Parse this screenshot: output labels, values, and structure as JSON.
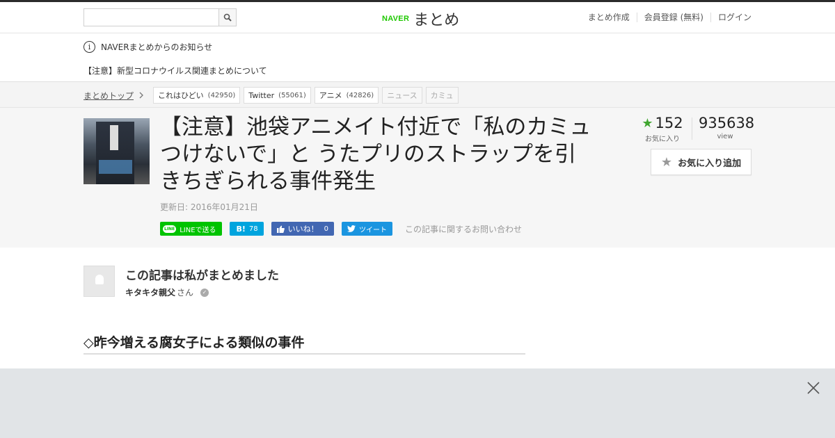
{
  "header": {
    "search_placeholder": "",
    "logo_brand": "NAVER",
    "logo_text": "まとめ",
    "nav": [
      "まとめ作成",
      "会員登録 (無料)",
      "ログイン"
    ]
  },
  "notice": {
    "heading": "NAVERまとめからのお知らせ",
    "link": "【注意】新型コロナウイルス関連まとめについて"
  },
  "breadcrumb": {
    "top": "まとめトップ",
    "tags": [
      {
        "label": "これはひどい",
        "count": "(42950)"
      },
      {
        "label": "Twitter",
        "count": "(55061)"
      },
      {
        "label": "アニメ",
        "count": "(42826)"
      },
      {
        "label": "ニュース",
        "count": ""
      },
      {
        "label": "カミュ",
        "count": ""
      }
    ]
  },
  "article": {
    "title": "【注意】池袋アニメイト付近で「私のカミュつけないで」と うたプリのストラップを引きちぎられる事件発生",
    "updated": "更新日: 2016年01月21日",
    "favorites": "152",
    "favorites_label": "お気に入り",
    "views": "935638",
    "views_label": "view",
    "fav_button": "お気に入り追加"
  },
  "share": {
    "line": "LINEで送る",
    "line_icon": "LINE",
    "hatena_icon": "B!",
    "hatena_count": "78",
    "facebook": "いいね！",
    "facebook_count": "0",
    "twitter": "ツイート",
    "inquiry": "この記事に関するお問い合わせ"
  },
  "author": {
    "heading": "この記事は私がまとめました",
    "name": "キタキタ親父",
    "suffix": "さん"
  },
  "section": {
    "heading": "◇昨今増える腐女子による類似の事件"
  },
  "colors": {
    "accent_green": "#1ec800",
    "star_green": "#40a630",
    "overlay_bg": "#e1e4e7"
  }
}
